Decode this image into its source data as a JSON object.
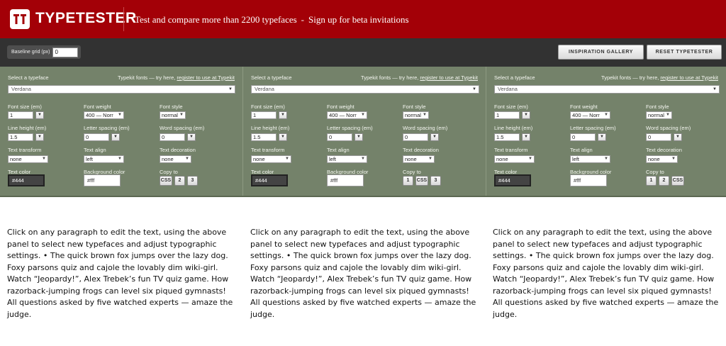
{
  "header": {
    "logo_text": "TYPETESTER",
    "tagline": "Test and compare more than 2200 typefaces",
    "tagline_sep": "-",
    "signup": "Sign up for beta invitations",
    "brand_color": "#a30007"
  },
  "toolbar": {
    "baseline_label": "Baseline grid (px)",
    "baseline_value": "0",
    "gallery_label": "INSPIRATION GALLERY",
    "reset_label": "RESET TYPETESTER"
  },
  "labels": {
    "select_typeface": "Select a typeface",
    "typekit_prefix": "Typekit fonts — try here,",
    "typekit_link": "register to use at Typekit",
    "font_size": "Font size (em)",
    "font_weight": "Font weight",
    "font_style": "Font style",
    "line_height": "Line height (em)",
    "letter_spacing": "Letter spacing (em)",
    "word_spacing": "Word spacing (em)",
    "text_transform": "Text transform",
    "text_align": "Text align",
    "text_decoration": "Text decoration",
    "text_color": "Text color",
    "background_color": "Background color",
    "copy_to": "Copy to"
  },
  "panels": [
    {
      "typeface": "Verdana",
      "font_size": "1",
      "font_weight": "400 — Norr",
      "font_style": "normal",
      "line_height": "1.5",
      "letter_spacing": "0",
      "word_spacing": "0",
      "text_transform": "none",
      "text_align": "left",
      "text_decoration": "none",
      "text_color": "#444",
      "background_color": "#fff",
      "copy_buttons": [
        "CSS",
        "2",
        "3"
      ]
    },
    {
      "typeface": "Verdana",
      "font_size": "1",
      "font_weight": "400 — Norr",
      "font_style": "normal",
      "line_height": "1.5",
      "letter_spacing": "0",
      "word_spacing": "0",
      "text_transform": "none",
      "text_align": "left",
      "text_decoration": "none",
      "text_color": "#444",
      "background_color": "#fff",
      "copy_buttons": [
        "1",
        "CSS",
        "3"
      ]
    },
    {
      "typeface": "Verdana",
      "font_size": "1",
      "font_weight": "400 — Norr",
      "font_style": "normal",
      "line_height": "1.5",
      "letter_spacing": "0",
      "word_spacing": "0",
      "text_transform": "none",
      "text_align": "left",
      "text_decoration": "none",
      "text_color": "#444",
      "background_color": "#fff",
      "copy_buttons": [
        "1",
        "2",
        "CSS"
      ]
    }
  ],
  "paragraph": "Click on any paragraph to edit the text, using the above panel to select new typefaces and adjust typographic settings. • The quick brown fox jumps over the lazy dog. Foxy parsons quiz and cajole the lovably dim wiki-girl. Watch “Jeopardy!”, Alex Trebek’s fun TV quiz game. How razorback-jumping frogs can level six piqued gymnasts! All questions asked by five watched experts — amaze the judge.",
  "icons": {
    "dropdown": "chevron-down-icon",
    "logo": "tt-logo-icon"
  }
}
